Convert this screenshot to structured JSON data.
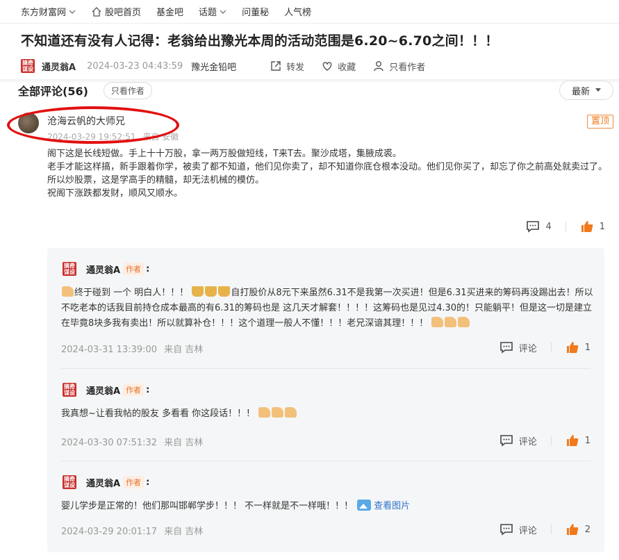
{
  "nav": {
    "site": "东方财富网",
    "home": "股吧首页",
    "fund": "基金吧",
    "topics": "话题",
    "ask": "问董秘",
    "popular": "人气榜"
  },
  "post": {
    "title": "不知道还有没有人记得：老翁给出豫光本周的活动范围是6.20~6.70之间！！！",
    "author": "通灵翁A",
    "seal_text": "搞奇谋设",
    "date": "2024-03-23 04:43:59",
    "bar": "豫光金铅吧",
    "share": "转发",
    "favorite": "收藏",
    "only_author": "只看作者"
  },
  "comments": {
    "heading": "全部评论(56)",
    "only_author": "只看作者",
    "sort": "最新"
  },
  "main_comment": {
    "name": "沧海云帆的大师兄",
    "date": "2024-03-29 19:52:51",
    "source": "来自 安徽",
    "pin": "置顶",
    "lines": [
      "阁下这是长线短做。手上十十万股，拿一两万股做短线，T来T去。聚沙成塔，集腋成裘。",
      "老手才能这样搞，新手跟着你学，被卖了都不知道，他们见你卖了，却不知道你底仓根本没动。他们见你买了，却忘了你之前高处就卖过了。",
      "所以炒股票，这是学高手的精髓，却无法机械的模仿。",
      "祝阁下涨跌都发财，顺风又顺水。"
    ],
    "comment_count": "4",
    "like_count": "1"
  },
  "replies": [
    {
      "name": "通灵翁A",
      "tag": "作者",
      "text_a": "终于碰到 一个 明白人！！！",
      "text_b": "自打股价从8元下来虽然6.31不是我第一次买进！但是6.31买进来的筹码再没踢出去！所以不吃老本的话我目前持仓成本最高的有6.31的筹码也是 这几天才解套！！！！这筹码也是见过4.30的！只能躺平！但是这一切是建立在毕竟8块多我有卖出！所以就算补仓！！！这个道理一般人不懂！！！老兄深谙其理！！！",
      "date": "2024-03-31 13:39:00",
      "source": "来自 吉林",
      "comment_label": "评论",
      "likes": "1"
    },
    {
      "name": "通灵翁A",
      "tag": "作者",
      "text": "我真想~让看我帖的股友 多看看 你这段话！！！",
      "date": "2024-03-30 07:51:32",
      "source": "来自 吉林",
      "comment_label": "评论",
      "likes": "1"
    },
    {
      "name": "通灵翁A",
      "tag": "作者",
      "text": "婴儿学步是正常的！他们那叫邯郸学步！！！ 不一样就是不一样哦！！！",
      "view_image": "查看图片",
      "date": "2024-03-29 20:01:17",
      "source": "来自 吉林",
      "comment_label": "评论",
      "likes": "2"
    }
  ],
  "colors": {
    "accent_red": "#e21010",
    "like_orange": "#f07a1c",
    "link_blue": "#2f74c8"
  }
}
